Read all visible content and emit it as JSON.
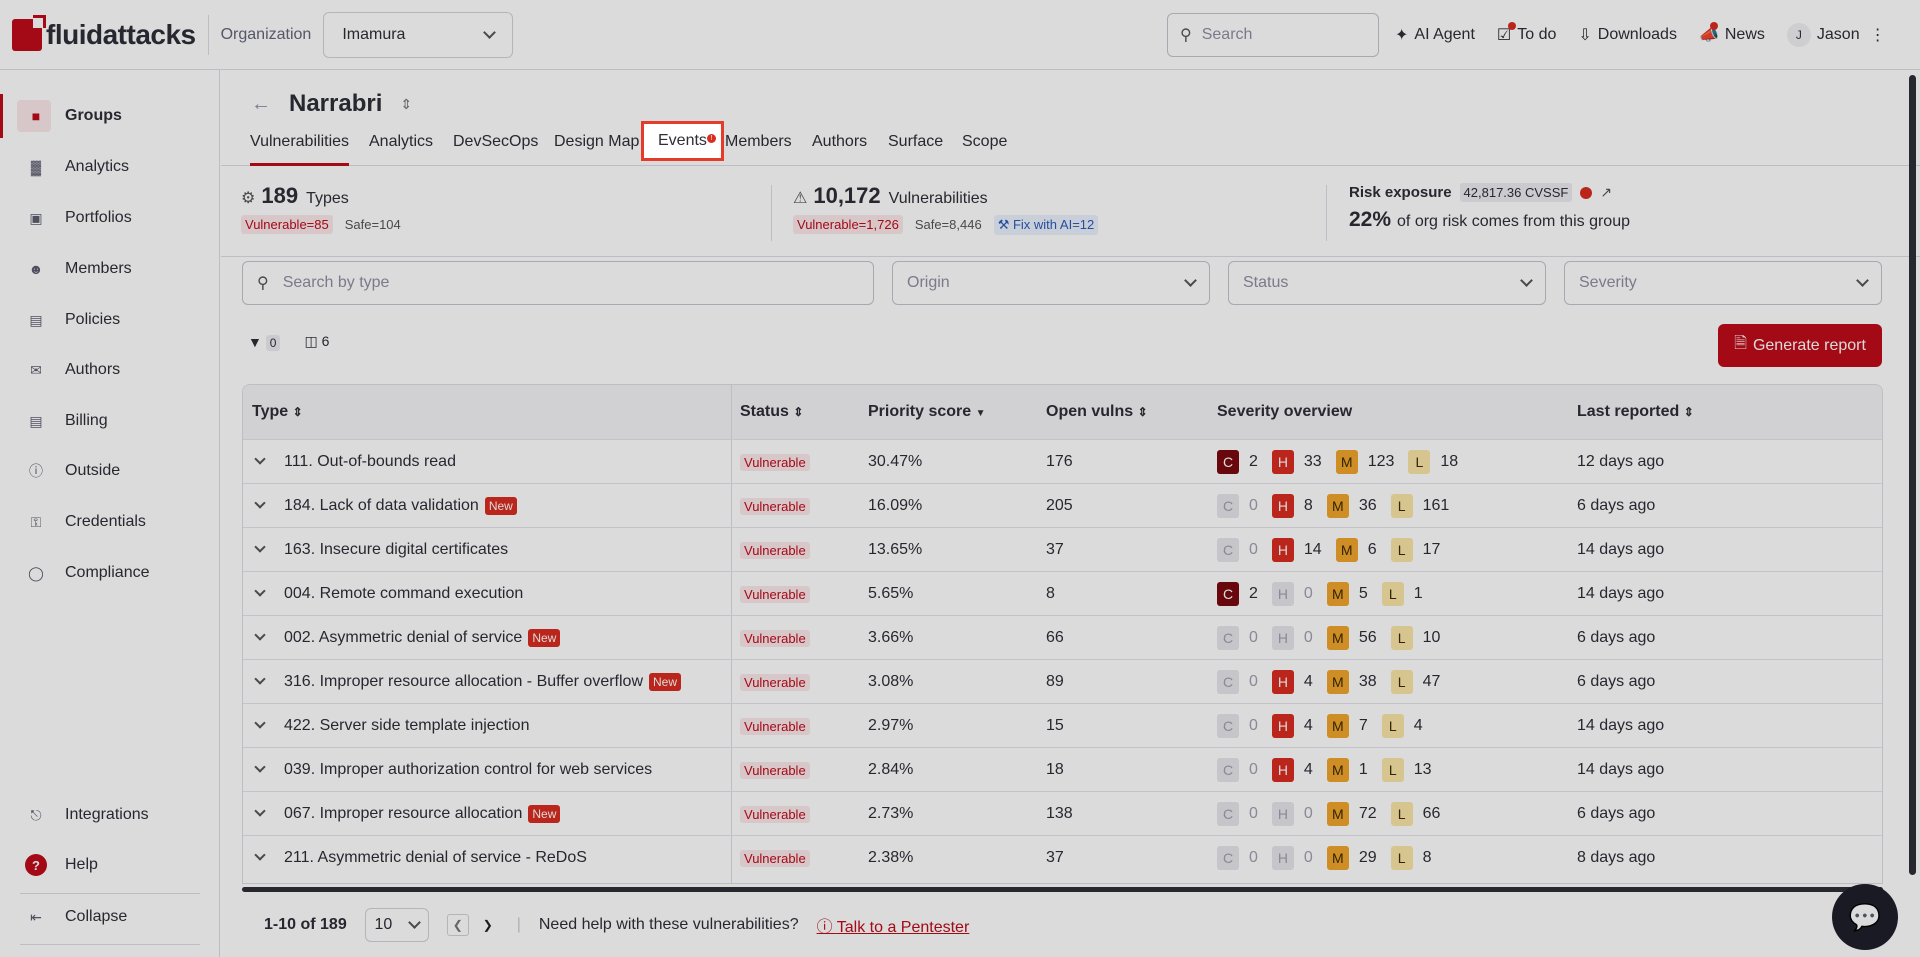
{
  "brand": {
    "logo_text_a": "fluid",
    "logo_text_b": "attacks"
  },
  "topbar": {
    "org_label": "Organization",
    "org_value": "Imamura",
    "search_placeholder": "Search",
    "nav": [
      "AI Agent",
      "To do",
      "Downloads",
      "News"
    ],
    "user_initial": "J",
    "user_name": "Jason"
  },
  "sidebar": {
    "items": [
      "Groups",
      "Analytics",
      "Portfolios",
      "Members",
      "Policies",
      "Authors",
      "Billing",
      "Outside",
      "Credentials",
      "Compliance"
    ],
    "bottom": [
      "Integrations",
      "Help",
      "Collapse"
    ]
  },
  "group": {
    "title": "Narrabri",
    "tabs": [
      "Vulnerabilities",
      "Analytics",
      "DevSecOps",
      "Design Map",
      "Events",
      "Members",
      "Authors",
      "Surface",
      "Scope"
    ],
    "events_badge": "!"
  },
  "stats": {
    "types_count": "189",
    "types_label": "Types",
    "types_vulnerable": "Vulnerable=85",
    "types_safe": "Safe=104",
    "vulns_count": "10,172",
    "vulns_label": "Vulnerabilities",
    "vulns_vulnerable": "Vulnerable=1,726",
    "vulns_safe": "Safe=8,446",
    "fix_ai": "Fix with AI=12",
    "risk_label": "Risk exposure",
    "risk_cvssf": "42,817.36 CVSSF",
    "risk_pct": "22%",
    "risk_text": "of org risk comes from this group"
  },
  "filters": {
    "search_placeholder": "Search by type",
    "origin": "Origin",
    "status": "Status",
    "severity": "Severity",
    "filter_count": "0",
    "columns_count": "6",
    "generate": "Generate report"
  },
  "table": {
    "headers": [
      "Type",
      "Status",
      "Priority score",
      "Open vulns",
      "Severity overview",
      "Last reported"
    ],
    "rows": [
      {
        "type": "111. Out-of-bounds read",
        "new": "",
        "status": "Vulnerable",
        "priority": "30.47%",
        "open": "176",
        "C": "2",
        "H": "33",
        "M": "123",
        "L": "18",
        "last": "12 days ago"
      },
      {
        "type": "184. Lack of data validation",
        "new": "New",
        "status": "Vulnerable",
        "priority": "16.09%",
        "open": "205",
        "C": "0",
        "H": "8",
        "M": "36",
        "L": "161",
        "last": "6 days ago"
      },
      {
        "type": "163. Insecure digital certificates",
        "new": "",
        "status": "Vulnerable",
        "priority": "13.65%",
        "open": "37",
        "C": "0",
        "H": "14",
        "M": "6",
        "L": "17",
        "last": "14 days ago"
      },
      {
        "type": "004. Remote command execution",
        "new": "",
        "status": "Vulnerable",
        "priority": "5.65%",
        "open": "8",
        "C": "2",
        "H": "0",
        "M": "5",
        "L": "1",
        "last": "14 days ago"
      },
      {
        "type": "002. Asymmetric denial of service",
        "new": "New",
        "status": "Vulnerable",
        "priority": "3.66%",
        "open": "66",
        "C": "0",
        "H": "0",
        "M": "56",
        "L": "10",
        "last": "6 days ago"
      },
      {
        "type": "316. Improper resource allocation - Buffer overflow",
        "new": "New",
        "status": "Vulnerable",
        "priority": "3.08%",
        "open": "89",
        "C": "0",
        "H": "4",
        "M": "38",
        "L": "47",
        "last": "6 days ago"
      },
      {
        "type": "422. Server side template injection",
        "new": "",
        "status": "Vulnerable",
        "priority": "2.97%",
        "open": "15",
        "C": "0",
        "H": "4",
        "M": "7",
        "L": "4",
        "last": "14 days ago"
      },
      {
        "type": "039. Improper authorization control for web services",
        "new": "",
        "status": "Vulnerable",
        "priority": "2.84%",
        "open": "18",
        "C": "0",
        "H": "4",
        "M": "1",
        "L": "13",
        "last": "14 days ago"
      },
      {
        "type": "067. Improper resource allocation",
        "new": "New",
        "status": "Vulnerable",
        "priority": "2.73%",
        "open": "138",
        "C": "0",
        "H": "0",
        "M": "72",
        "L": "66",
        "last": "6 days ago"
      },
      {
        "type": "211. Asymmetric denial of service - ReDoS",
        "new": "",
        "status": "Vulnerable",
        "priority": "2.38%",
        "open": "37",
        "C": "0",
        "H": "0",
        "M": "29",
        "L": "8",
        "last": "8 days ago"
      }
    ]
  },
  "pager": {
    "range": "1-10 of 189",
    "page_size": "10",
    "help_text": "Need help with these vulnerabilities?",
    "talk": "Talk to a Pentester"
  }
}
